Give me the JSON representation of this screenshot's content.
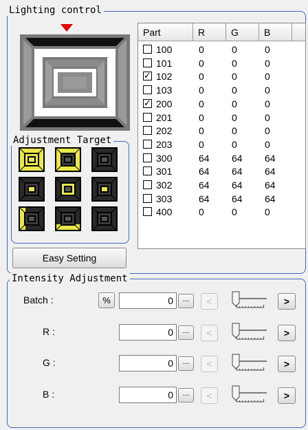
{
  "lighting_control": {
    "title": "Lighting control",
    "adjustment_target_title": "Adjustment Target",
    "easy_setting_label": "Easy Setting",
    "table": {
      "headers": [
        "Part",
        "R",
        "G",
        "B"
      ],
      "rows": [
        {
          "part": "100",
          "checked": false,
          "r": "0",
          "g": "0",
          "b": "0"
        },
        {
          "part": "101",
          "checked": false,
          "r": "0",
          "g": "0",
          "b": "0"
        },
        {
          "part": "102",
          "checked": true,
          "r": "0",
          "g": "0",
          "b": "0"
        },
        {
          "part": "103",
          "checked": false,
          "r": "0",
          "g": "0",
          "b": "0"
        },
        {
          "part": "200",
          "checked": true,
          "r": "0",
          "g": "0",
          "b": "0"
        },
        {
          "part": "201",
          "checked": false,
          "r": "0",
          "g": "0",
          "b": "0"
        },
        {
          "part": "202",
          "checked": false,
          "r": "0",
          "g": "0",
          "b": "0"
        },
        {
          "part": "203",
          "checked": false,
          "r": "0",
          "g": "0",
          "b": "0"
        },
        {
          "part": "300",
          "checked": false,
          "r": "64",
          "g": "64",
          "b": "64"
        },
        {
          "part": "301",
          "checked": false,
          "r": "64",
          "g": "64",
          "b": "64"
        },
        {
          "part": "302",
          "checked": false,
          "r": "64",
          "g": "64",
          "b": "64"
        },
        {
          "part": "303",
          "checked": false,
          "r": "64",
          "g": "64",
          "b": "64"
        },
        {
          "part": "400",
          "checked": false,
          "r": "0",
          "g": "0",
          "b": "0"
        }
      ]
    },
    "colors": {
      "accent": "#3d68b8",
      "indicator": "#e30000",
      "highlight": "#e8e84a"
    }
  },
  "intensity": {
    "title": "Intensity Adjustment",
    "percent_label": "%",
    "ellipsis_label": "...",
    "dec_label": "<",
    "inc_label": ">",
    "rows": [
      {
        "label": "Batch :",
        "value": "0",
        "slider_position": 0
      },
      {
        "label": "R :",
        "value": "0",
        "slider_position": 0
      },
      {
        "label": "G :",
        "value": "0",
        "slider_position": 0
      },
      {
        "label": "B :",
        "value": "0",
        "slider_position": 0
      }
    ]
  }
}
